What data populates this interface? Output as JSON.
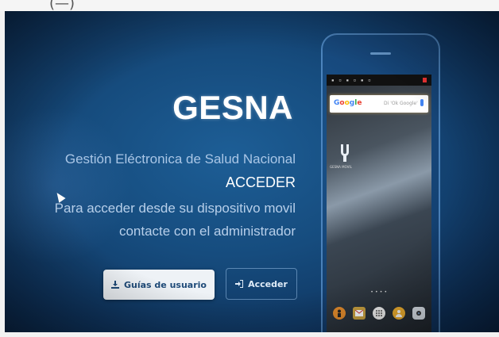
{
  "top_fragment": "(—)",
  "page": {
    "title": "GESNA",
    "subtitle": "Gestión Eléctronica de Salud Nacional",
    "access_label": "ACCEDER",
    "info_line1": "Para acceder desde su dispositivo movil",
    "info_line2": "contacte con el administrador"
  },
  "buttons": {
    "guides": {
      "label": "Guías de usuario",
      "icon": "download-icon"
    },
    "login": {
      "label": "Acceder",
      "icon": "sign-in-icon"
    }
  },
  "phone": {
    "search_widget": {
      "brand": "Google",
      "placeholder": "Di 'Ok Google'",
      "icon": "mic-icon"
    },
    "app_label": "GESNA MOVIL",
    "page_indicator": "• • • •",
    "dock_icons": [
      "person-icon",
      "mail-icon",
      "apps-icon",
      "contact-icon",
      "camera-icon"
    ]
  },
  "colors": {
    "background": "#164c7e",
    "title_text": "#ffffff",
    "subtitle_text": "#a9c6e6",
    "guides_button_bg": "#eef2f6",
    "guides_button_text": "#1e4a78",
    "login_button_border": "#96bee6"
  }
}
